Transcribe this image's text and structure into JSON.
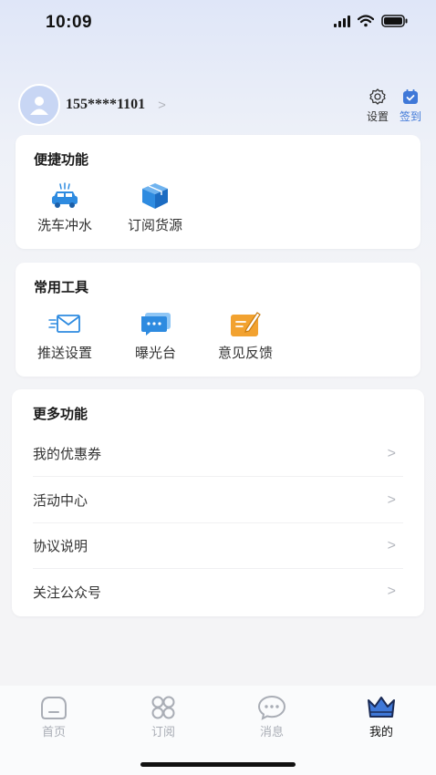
{
  "status": {
    "time": "10:09"
  },
  "profile": {
    "phone": "155****1101",
    "chevron": ">"
  },
  "top_actions": {
    "settings_label": "设置",
    "checkin_label": "签到"
  },
  "quick": {
    "title": "便捷功能",
    "items": [
      {
        "label": "洗车冲水",
        "icon": "car-wash-icon"
      },
      {
        "label": "订阅货源",
        "icon": "package-box-icon"
      }
    ]
  },
  "tools": {
    "title": "常用工具",
    "items": [
      {
        "label": "推送设置",
        "icon": "envelope-icon"
      },
      {
        "label": "曝光台",
        "icon": "message-bubble-icon"
      },
      {
        "label": "意见反馈",
        "icon": "feedback-pen-icon"
      }
    ]
  },
  "more": {
    "title": "更多功能",
    "chevron": ">",
    "items": [
      {
        "label": "我的优惠券"
      },
      {
        "label": "活动中心"
      },
      {
        "label": "协议说明"
      },
      {
        "label": "关注公众号"
      }
    ]
  },
  "tabs": [
    {
      "label": "首页",
      "icon": "home-icon",
      "active": false
    },
    {
      "label": "订阅",
      "icon": "subscribe-grid-icon",
      "active": false
    },
    {
      "label": "消息",
      "icon": "chat-bubble-icon",
      "active": false
    },
    {
      "label": "我的",
      "icon": "crown-icon",
      "active": true
    }
  ],
  "colors": {
    "accent": "#3f78d8",
    "tool_blue": "#2e8be0",
    "feedback_orange": "#f2a230"
  }
}
